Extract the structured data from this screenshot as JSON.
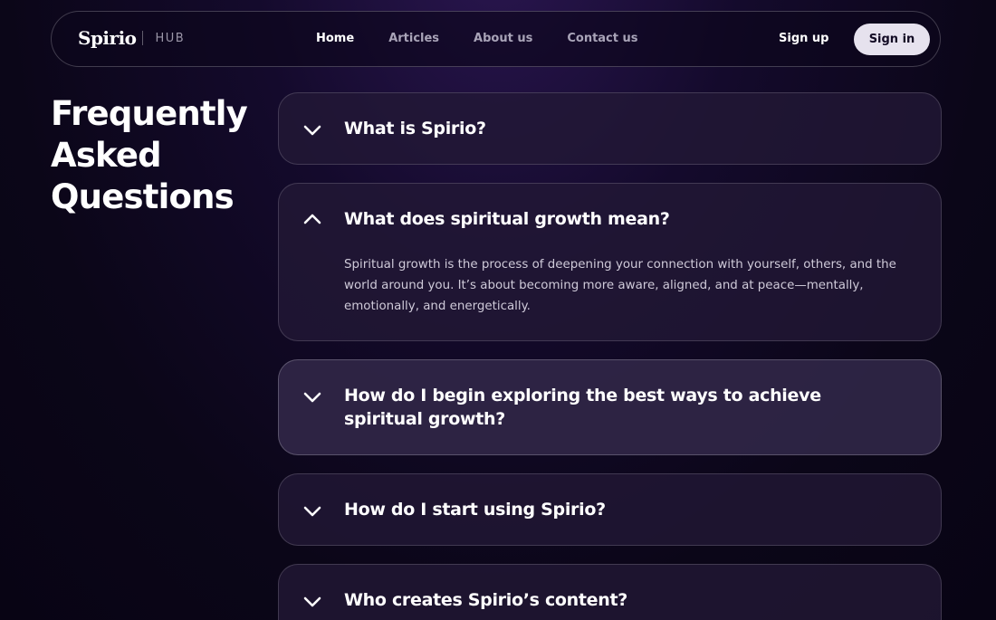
{
  "nav": {
    "logo": "Spirio",
    "hub": "HUB",
    "links": [
      "Home",
      "Articles",
      "About us",
      "Contact us"
    ],
    "signup": "Sign up",
    "signin": "Sign in"
  },
  "faq": {
    "title_lines": [
      "Frequently",
      "Asked",
      "Questions"
    ],
    "items": [
      {
        "question": "What is Spirio?",
        "icon": "chevron-down-icon"
      },
      {
        "question": "What does spiritual growth mean?",
        "icon": "chevron-up-icon",
        "answer": "Spiritual growth is the process of deepening your connection with yourself, others, and the world around you. It’s about becoming more aware, aligned, and at peace—mentally, emotionally, and energetically."
      },
      {
        "question": "How do I begin exploring the best ways to achieve spiritual growth?",
        "icon": "chevron-down-icon"
      },
      {
        "question": "How do I start using Spirio?",
        "icon": "chevron-down-icon"
      },
      {
        "question": "Who creates Spirio’s content?",
        "icon": "chevron-down-icon"
      }
    ]
  }
}
